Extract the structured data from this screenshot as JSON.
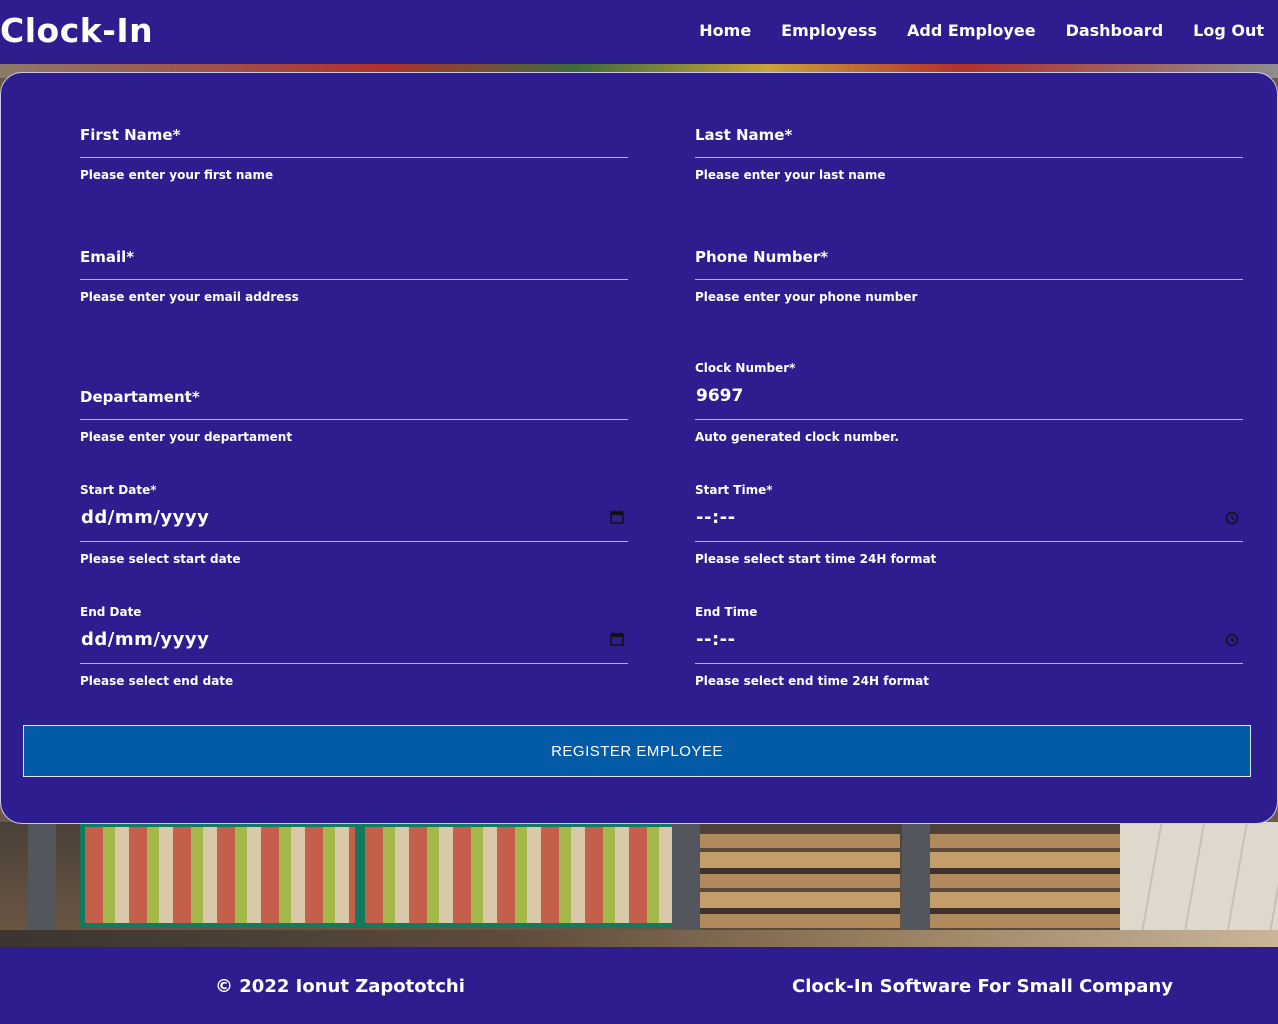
{
  "header": {
    "brand": "Clock-In",
    "nav": [
      "Home",
      "Employess",
      "Add Employee",
      "Dashboard",
      "Log Out"
    ]
  },
  "form": {
    "first_name": {
      "label": "First Name*",
      "help": "Please enter your first name"
    },
    "last_name": {
      "label": "Last Name*",
      "help": "Please enter your last name"
    },
    "email": {
      "label": "Email*",
      "help": "Please enter your email address"
    },
    "phone": {
      "label": "Phone Number*",
      "help": "Please enter your phone number"
    },
    "department": {
      "label": "Departament*",
      "help": "Please enter your departament"
    },
    "clock_number": {
      "label": "Clock Number*",
      "value": "9697",
      "help": "Auto generated clock number."
    },
    "start_date": {
      "label": "Start Date*",
      "value": "dd/mm/yyyy",
      "help": "Please select start date"
    },
    "start_time": {
      "label": "Start Time*",
      "value": "--:--",
      "help": "Please select start time 24H format"
    },
    "end_date": {
      "label": "End Date",
      "value": "dd/mm/yyyy",
      "help": "Please select end date"
    },
    "end_time": {
      "label": "End Time",
      "value": "--:--",
      "help": "Please select end time 24H format"
    },
    "submit_label": "REGISTER EMPLOYEE"
  },
  "footer": {
    "copyright": "© 2022 Ionut Zapototchi",
    "tagline": "Clock-In Software For Small Company"
  },
  "colors": {
    "primary": "#2e1d8f",
    "button": "#035aa6"
  }
}
